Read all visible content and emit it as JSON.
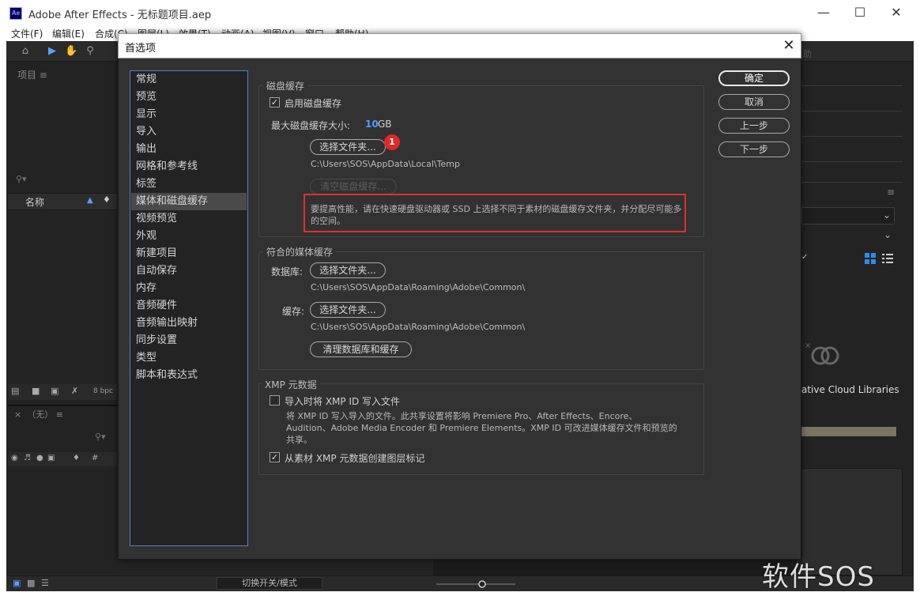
{
  "window": {
    "title": "Adobe After Effects - 无标题项目.aep",
    "app_icon": "Ae"
  },
  "menu": [
    "文件(F)",
    "编辑(E)",
    "合成(C)",
    "图层(L)",
    "效果(T)",
    "动画(A)",
    "视图(V)",
    "窗口",
    "帮助(H)"
  ],
  "workspace": {
    "project_label": "项目",
    "col_name": "名称",
    "bpc": "8 bpc",
    "timeline_none": "（无）",
    "switch_mode": "切换开关/模式",
    "help_frag": "助",
    "cc_text": "ative Cloud Libraries",
    "watermark": "软件SOS"
  },
  "dialog": {
    "title": "首选项",
    "nav": [
      "常规",
      "预览",
      "显示",
      "导入",
      "输出",
      "网格和参考线",
      "标签",
      "媒体和磁盘缓存",
      "视频预览",
      "外观",
      "新建项目",
      "自动保存",
      "内存",
      "音频硬件",
      "音频输出映射",
      "同步设置",
      "类型",
      "脚本和表达式"
    ],
    "selected_nav": "媒体和磁盘缓存",
    "disk_cache": {
      "group_title": "磁盘缓存",
      "enable_label": "启用磁盘缓存",
      "enable_checked": true,
      "max_size_label": "最大磁盘缓存大小:",
      "max_size_value": "10",
      "max_size_unit": "GB",
      "choose_folder": "选择文件夹...",
      "path": "C:\\Users\\SOS\\AppData\\Local\\Temp",
      "clear_cache": "清空磁盘缓存...",
      "tip": "要提高性能，请在快速硬盘驱动器或 SSD 上选择不同于素材的磁盘缓存文件夹，并分配尽可能多的空间。",
      "badge": "1"
    },
    "conformed_cache": {
      "group_title": "符合的媒体缓存",
      "database_label": "数据库:",
      "database_button": "选择文件夹...",
      "database_path": "C:\\Users\\SOS\\AppData\\Roaming\\Adobe\\Common\\",
      "cache_label": "缓存:",
      "cache_button": "选择文件夹...",
      "cache_path": "C:\\Users\\SOS\\AppData\\Roaming\\Adobe\\Common\\",
      "clean_button": "清理数据库和缓存"
    },
    "xmp": {
      "group_title": "XMP 元数据",
      "write_label": "导入时将 XMP ID 写入文件",
      "write_checked": false,
      "write_note": "将 XMP ID 写入导入的文件。此共享设置将影响 Premiere Pro、After Effects、Encore、Audition、Adobe Media Encoder 和 Premiere Elements。XMP ID 可改进媒体缓存文件和预览的共享。",
      "markers_label": "从素材 XMP 元数据创建图层标记",
      "markers_checked": true
    },
    "buttons": {
      "ok": "确定",
      "cancel": "取消",
      "prev": "上一步",
      "next": "下一步"
    }
  }
}
